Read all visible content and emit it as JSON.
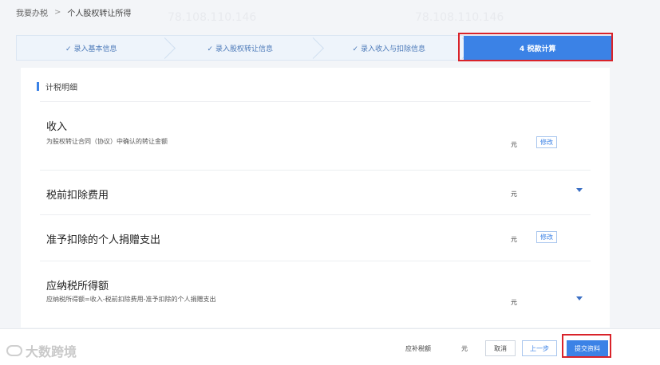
{
  "breadcrumb": {
    "root": "我要办税",
    "sep": ">",
    "current": "个人股权转让所得"
  },
  "steps": [
    {
      "label": "✓ 录入基本信息",
      "active": false
    },
    {
      "label": "✓ 录入股权转让信息",
      "active": false
    },
    {
      "label": "✓ 录入收入与扣除信息",
      "active": false
    },
    {
      "label": "4  税款计算",
      "active": true
    }
  ],
  "section": {
    "title": "计税明细"
  },
  "rows": [
    {
      "label": "收入",
      "note": "为股权转让合同（协议）中确认的转让金额",
      "unit": "元",
      "action": "修改",
      "icon": "chevron-down-icon"
    },
    {
      "label": "税前扣除费用",
      "note": "",
      "unit": "元",
      "action": "",
      "icon": "chevron-down-icon"
    },
    {
      "label": "准予扣除的个人捐赠支出",
      "note": "",
      "unit": "元",
      "action": "修改",
      "icon": ""
    },
    {
      "label": "应纳税所得额",
      "note": "应纳税所得额=收入-税前扣除费用-准予扣除的个人捐赠支出",
      "unit": "元",
      "action": "",
      "icon": "chevron-down-icon"
    }
  ],
  "footer": {
    "brand": "大数跨境",
    "due_label": "应补税额",
    "due_unit": "元",
    "cancel": "取消",
    "prev": "上一步",
    "submit": "提交资料"
  },
  "watermark": "78.108.110.146",
  "colors": {
    "accent": "#3b82e6",
    "highlight_border": "#d9232a"
  }
}
